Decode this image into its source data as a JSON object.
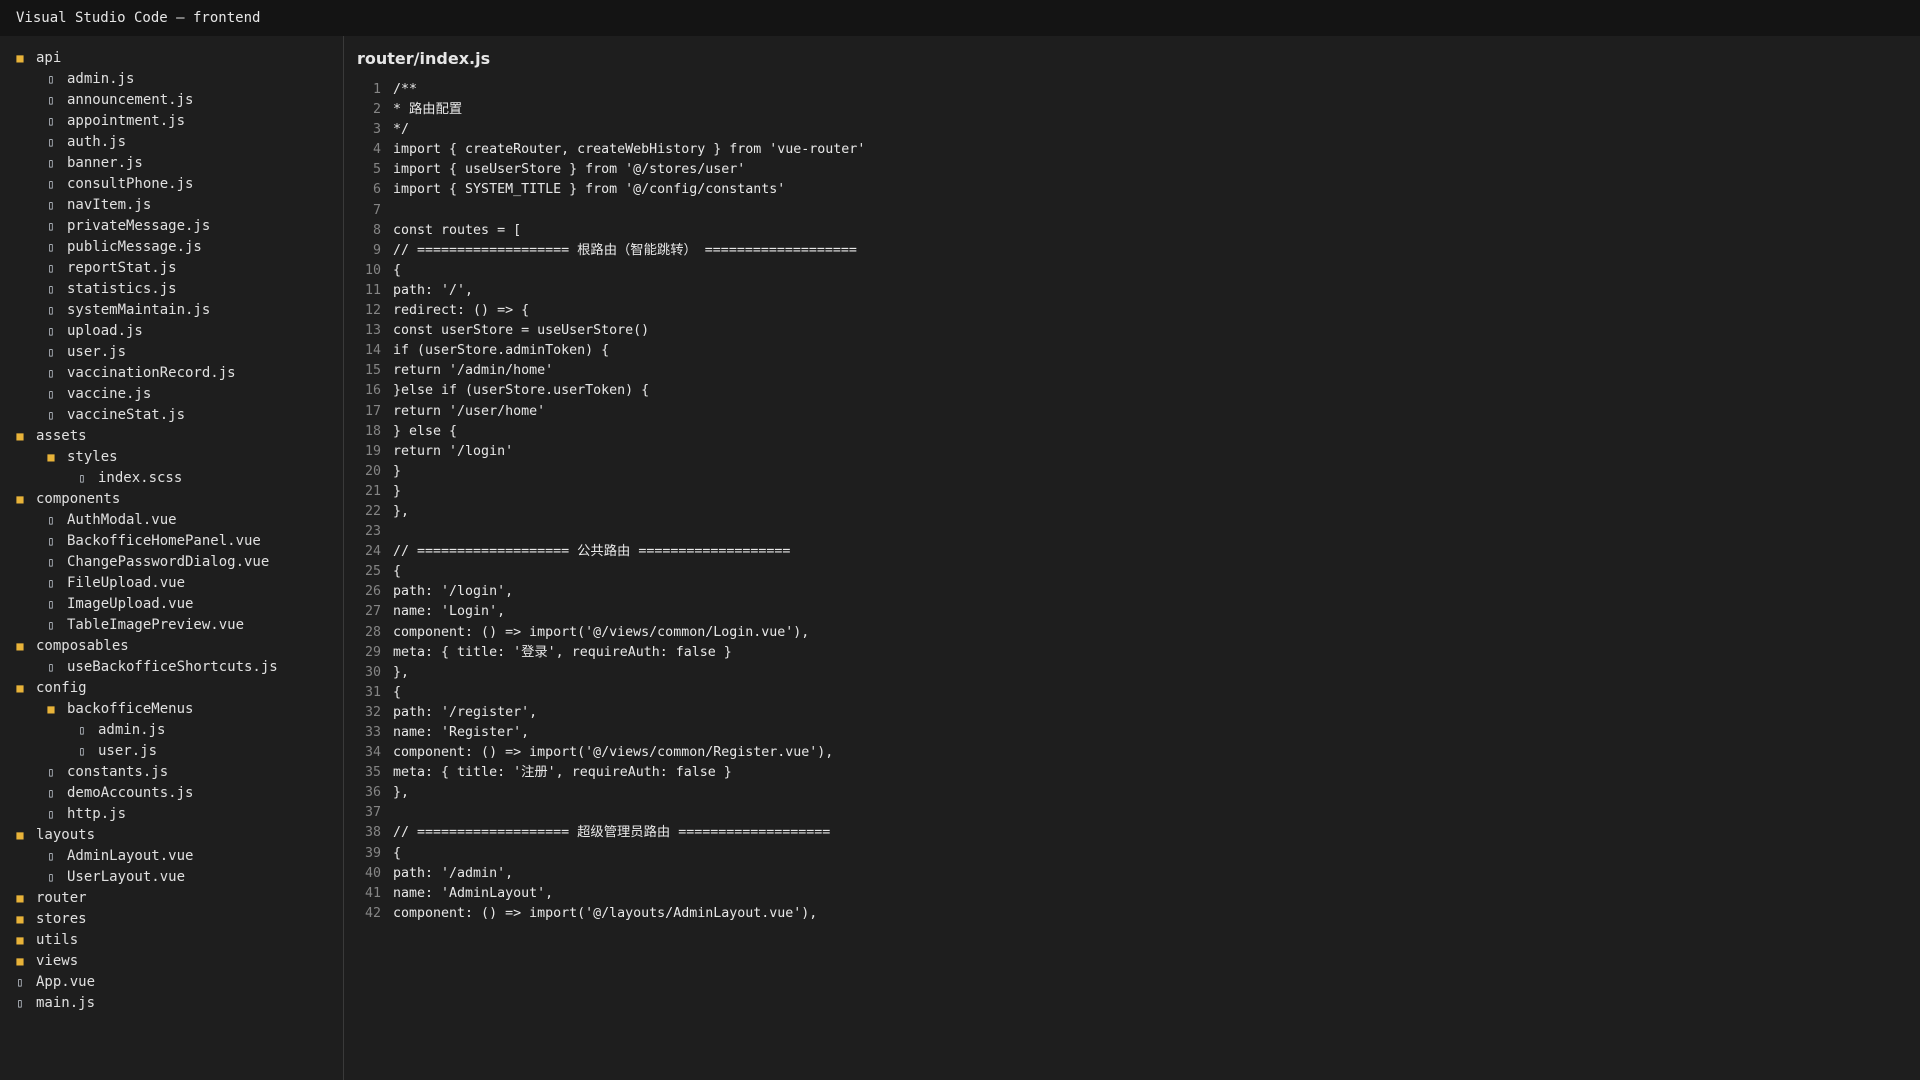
{
  "window": {
    "title": "Visual Studio Code — frontend"
  },
  "colors": {
    "folder": "#e8b339",
    "background": "#1e1e1e",
    "titlebar": "#141414"
  },
  "explorer": {
    "items": [
      {
        "name": "api",
        "type": "folder",
        "depth": 0,
        "icon": "folder-icon"
      },
      {
        "name": "admin.js",
        "type": "file",
        "depth": 1,
        "icon": "file-icon"
      },
      {
        "name": "announcement.js",
        "type": "file",
        "depth": 1,
        "icon": "file-icon"
      },
      {
        "name": "appointment.js",
        "type": "file",
        "depth": 1,
        "icon": "file-icon"
      },
      {
        "name": "auth.js",
        "type": "file",
        "depth": 1,
        "icon": "file-icon"
      },
      {
        "name": "banner.js",
        "type": "file",
        "depth": 1,
        "icon": "file-icon"
      },
      {
        "name": "consultPhone.js",
        "type": "file",
        "depth": 1,
        "icon": "file-icon"
      },
      {
        "name": "navItem.js",
        "type": "file",
        "depth": 1,
        "icon": "file-icon"
      },
      {
        "name": "privateMessage.js",
        "type": "file",
        "depth": 1,
        "icon": "file-icon"
      },
      {
        "name": "publicMessage.js",
        "type": "file",
        "depth": 1,
        "icon": "file-icon"
      },
      {
        "name": "reportStat.js",
        "type": "file",
        "depth": 1,
        "icon": "file-icon"
      },
      {
        "name": "statistics.js",
        "type": "file",
        "depth": 1,
        "icon": "file-icon"
      },
      {
        "name": "systemMaintain.js",
        "type": "file",
        "depth": 1,
        "icon": "file-icon"
      },
      {
        "name": "upload.js",
        "type": "file",
        "depth": 1,
        "icon": "file-icon"
      },
      {
        "name": "user.js",
        "type": "file",
        "depth": 1,
        "icon": "file-icon"
      },
      {
        "name": "vaccinationRecord.js",
        "type": "file",
        "depth": 1,
        "icon": "file-icon"
      },
      {
        "name": "vaccine.js",
        "type": "file",
        "depth": 1,
        "icon": "file-icon"
      },
      {
        "name": "vaccineStat.js",
        "type": "file",
        "depth": 1,
        "icon": "file-icon"
      },
      {
        "name": "assets",
        "type": "folder",
        "depth": 0,
        "icon": "folder-icon"
      },
      {
        "name": "styles",
        "type": "folder",
        "depth": 1,
        "icon": "folder-icon"
      },
      {
        "name": "index.scss",
        "type": "file",
        "depth": 2,
        "icon": "file-icon"
      },
      {
        "name": "components",
        "type": "folder",
        "depth": 0,
        "icon": "folder-icon"
      },
      {
        "name": "AuthModal.vue",
        "type": "file",
        "depth": 1,
        "icon": "file-icon"
      },
      {
        "name": "BackofficeHomePanel.vue",
        "type": "file",
        "depth": 1,
        "icon": "file-icon"
      },
      {
        "name": "ChangePasswordDialog.vue",
        "type": "file",
        "depth": 1,
        "icon": "file-icon"
      },
      {
        "name": "FileUpload.vue",
        "type": "file",
        "depth": 1,
        "icon": "file-icon"
      },
      {
        "name": "ImageUpload.vue",
        "type": "file",
        "depth": 1,
        "icon": "file-icon"
      },
      {
        "name": "TableImagePreview.vue",
        "type": "file",
        "depth": 1,
        "icon": "file-icon"
      },
      {
        "name": "composables",
        "type": "folder",
        "depth": 0,
        "icon": "folder-icon"
      },
      {
        "name": "useBackofficeShortcuts.js",
        "type": "file",
        "depth": 1,
        "icon": "file-icon"
      },
      {
        "name": "config",
        "type": "folder",
        "depth": 0,
        "icon": "folder-icon"
      },
      {
        "name": "backofficeMenus",
        "type": "folder",
        "depth": 1,
        "icon": "folder-icon"
      },
      {
        "name": "admin.js",
        "type": "file",
        "depth": 2,
        "icon": "file-icon"
      },
      {
        "name": "user.js",
        "type": "file",
        "depth": 2,
        "icon": "file-icon"
      },
      {
        "name": "constants.js",
        "type": "file",
        "depth": 1,
        "icon": "file-icon"
      },
      {
        "name": "demoAccounts.js",
        "type": "file",
        "depth": 1,
        "icon": "file-icon"
      },
      {
        "name": "http.js",
        "type": "file",
        "depth": 1,
        "icon": "file-icon"
      },
      {
        "name": "layouts",
        "type": "folder",
        "depth": 0,
        "icon": "folder-icon"
      },
      {
        "name": "AdminLayout.vue",
        "type": "file",
        "depth": 1,
        "icon": "file-icon"
      },
      {
        "name": "UserLayout.vue",
        "type": "file",
        "depth": 1,
        "icon": "file-icon"
      },
      {
        "name": "router",
        "type": "folder",
        "depth": 0,
        "icon": "folder-icon"
      },
      {
        "name": "stores",
        "type": "folder",
        "depth": 0,
        "icon": "folder-icon"
      },
      {
        "name": "utils",
        "type": "folder",
        "depth": 0,
        "icon": "folder-icon"
      },
      {
        "name": "views",
        "type": "folder",
        "depth": 0,
        "icon": "folder-icon"
      },
      {
        "name": "App.vue",
        "type": "file",
        "depth": 0,
        "icon": "file-icon"
      },
      {
        "name": "main.js",
        "type": "file",
        "depth": 0,
        "icon": "file-icon"
      }
    ]
  },
  "editor": {
    "file_title": "router/index.js",
    "lines": [
      {
        "no": "1",
        "text": "/**"
      },
      {
        "no": "2",
        "text": "* 路由配置"
      },
      {
        "no": "3",
        "text": "*/"
      },
      {
        "no": "4",
        "text": "import { createRouter, createWebHistory } from 'vue-router'"
      },
      {
        "no": "5",
        "text": "import { useUserStore } from '@/stores/user'"
      },
      {
        "no": "6",
        "text": "import { SYSTEM_TITLE } from '@/config/constants'"
      },
      {
        "no": "7",
        "text": ""
      },
      {
        "no": "8",
        "text": "const routes = ["
      },
      {
        "no": "9",
        "text": "// =================== 根路由（智能跳转） ==================="
      },
      {
        "no": "10",
        "text": "{"
      },
      {
        "no": "11",
        "text": "path: '/',"
      },
      {
        "no": "12",
        "text": "redirect: () => {"
      },
      {
        "no": "13",
        "text": "const userStore = useUserStore()"
      },
      {
        "no": "14",
        "text": "if (userStore.adminToken) {"
      },
      {
        "no": "15",
        "text": "return '/admin/home'"
      },
      {
        "no": "16",
        "text": "}else if (userStore.userToken) {"
      },
      {
        "no": "17",
        "text": "return '/user/home'"
      },
      {
        "no": "18",
        "text": "} else {"
      },
      {
        "no": "19",
        "text": "return '/login'"
      },
      {
        "no": "20",
        "text": "}"
      },
      {
        "no": "21",
        "text": "}"
      },
      {
        "no": "22",
        "text": "},"
      },
      {
        "no": "23",
        "text": ""
      },
      {
        "no": "24",
        "text": "// =================== 公共路由 ==================="
      },
      {
        "no": "25",
        "text": "{"
      },
      {
        "no": "26",
        "text": "path: '/login',"
      },
      {
        "no": "27",
        "text": "name: 'Login',"
      },
      {
        "no": "28",
        "text": "component: () => import('@/views/common/Login.vue'),"
      },
      {
        "no": "29",
        "text": "meta: { title: '登录', requireAuth: false }"
      },
      {
        "no": "30",
        "text": "},"
      },
      {
        "no": "31",
        "text": "{"
      },
      {
        "no": "32",
        "text": "path: '/register',"
      },
      {
        "no": "33",
        "text": "name: 'Register',"
      },
      {
        "no": "34",
        "text": "component: () => import('@/views/common/Register.vue'),"
      },
      {
        "no": "35",
        "text": "meta: { title: '注册', requireAuth: false }"
      },
      {
        "no": "36",
        "text": "},"
      },
      {
        "no": "37",
        "text": ""
      },
      {
        "no": "38",
        "text": "// =================== 超级管理员路由 ==================="
      },
      {
        "no": "39",
        "text": "{"
      },
      {
        "no": "40",
        "text": "path: '/admin',"
      },
      {
        "no": "41",
        "text": "name: 'AdminLayout',"
      },
      {
        "no": "42",
        "text": "component: () => import('@/layouts/AdminLayout.vue'),"
      }
    ]
  }
}
